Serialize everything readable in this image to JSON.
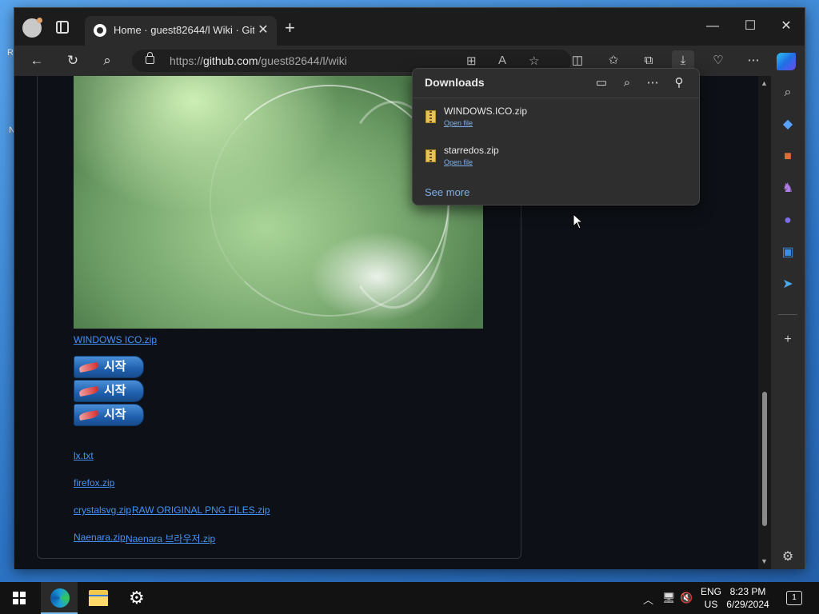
{
  "desktop": {
    "frag_r": "R",
    "frag_n": "N"
  },
  "browser": {
    "tab_title": "Home · guest82644/l Wiki · GitHub",
    "tab_close": "✕",
    "new_tab": "+",
    "window_controls": {
      "minimize": "—",
      "maximize": "☐",
      "close": "✕"
    },
    "nav": {
      "back": "←",
      "refresh": "↻",
      "search": "⌕"
    },
    "url_prefix": "https://",
    "url_host": "github.com",
    "url_path": "/guest82644/l/wiki",
    "toolbar_icons": [
      "split-screen-icon",
      "favorites-icon",
      "collections-icon",
      "downloads-icon",
      "browser-essentials-icon",
      "more-icon"
    ]
  },
  "wiki": {
    "windows_ico_link": "WINDOWS ICO.zip",
    "start_buttons": [
      "시작",
      "시작",
      "시작"
    ],
    "lx_link": "lx.txt",
    "firefox_link": "firefox.zip",
    "crystalsvg_link": "crystalsvg.zip",
    "raw_png_link": "RAW ORIGINAL PNG FILES.zip",
    "naenara_link": "Naenara.zip",
    "naenara_browser_link": "Naenara 브라우저.zip"
  },
  "downloads": {
    "title": "Downloads",
    "items": [
      {
        "name": "WINDOWS.ICO.zip",
        "action": "Open file"
      },
      {
        "name": "starredos.zip",
        "action": "Open file"
      }
    ],
    "see_more": "See more"
  },
  "sidebar": {
    "add": "+"
  },
  "taskbar": {
    "lang_top": "ENG",
    "lang_bottom": "US",
    "time": "8:23 PM",
    "date": "6/29/2024",
    "notifications": "1"
  },
  "colors": {
    "link": "#4493f8",
    "page_bg": "#0d1117",
    "accent": "#76b9ed"
  }
}
